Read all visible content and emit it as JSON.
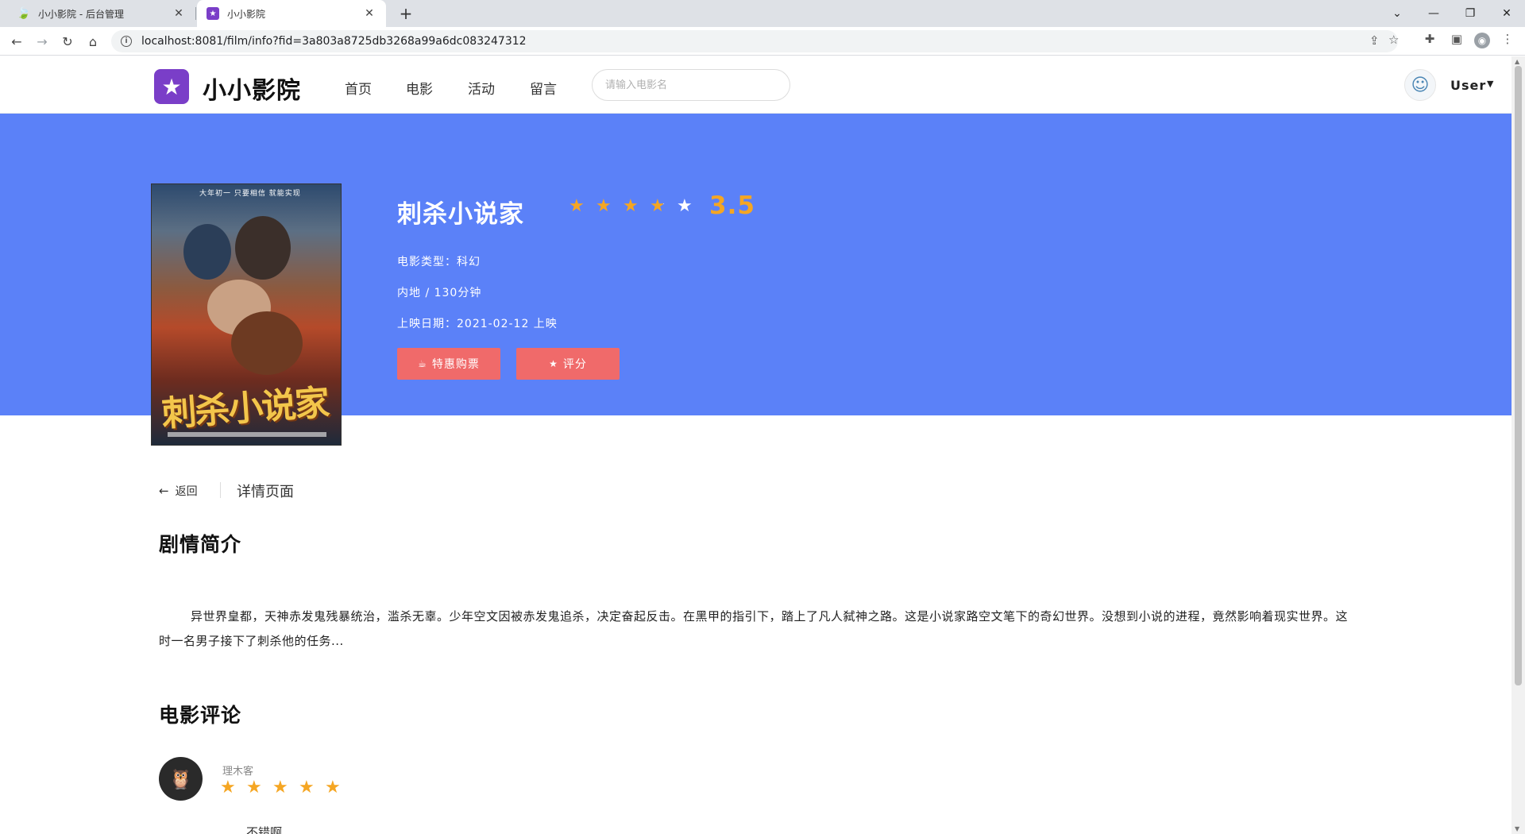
{
  "browser": {
    "tabs": [
      {
        "title": "小小影院 - 后台管理",
        "active": false
      },
      {
        "title": "小小影院",
        "active": true
      }
    ],
    "url": "localhost:8081/film/info?fid=3a803a8725db3268a99a6dc083247312"
  },
  "header": {
    "site_name": "小小影院",
    "nav": [
      "首页",
      "电影",
      "活动",
      "留言"
    ],
    "search_placeholder": "请输入电影名",
    "user_name": "User"
  },
  "film": {
    "title": "刺杀小说家",
    "rating": 3.5,
    "rating_text": "3.5",
    "type_line": "电影类型：科幻",
    "region_line": "内地 / 130分钟",
    "release_line": "上映日期：2021-02-12 上映",
    "poster_title": "刺杀小说家",
    "poster_tagline": "大年初一 只要相信 就能实现"
  },
  "buttons": {
    "buy": "特惠购票",
    "rate": "评分"
  },
  "breadcrumb": {
    "back": "返回",
    "page": "详情页面"
  },
  "sections": {
    "synopsis_title": "剧情简介",
    "synopsis": "异世界皇都，天神赤发鬼残暴统治，滥杀无辜。少年空文因被赤发鬼追杀，决定奋起反击。在黑甲的指引下，踏上了凡人弑神之路。这是小说家路空文笔下的奇幻世界。没想到小说的进程，竟然影响着现实世界。这时一名男子接下了刺杀他的任务...",
    "comments_title": "电影评论"
  },
  "comments": [
    {
      "user": "理木客",
      "stars": 5,
      "text": "不错啊"
    }
  ],
  "colors": {
    "hero_bg": "#5b81f8",
    "accent_star": "#f5a623",
    "button": "#f06a6a",
    "brand": "#7a3ec8"
  }
}
